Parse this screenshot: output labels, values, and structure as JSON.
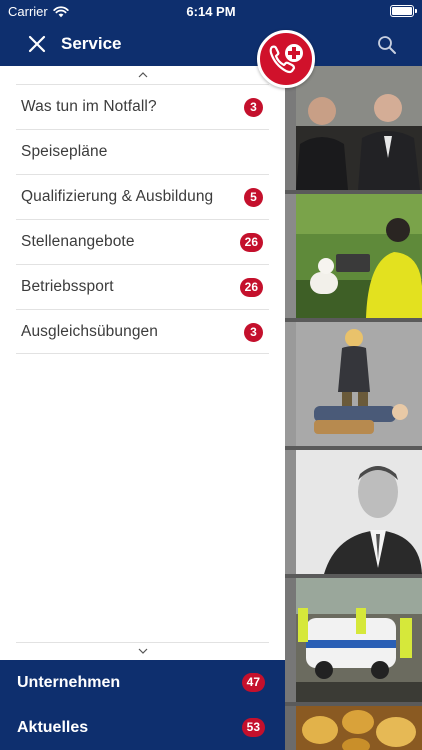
{
  "status_bar": {
    "carrier": "Carrier",
    "time": "6:14 PM"
  },
  "header": {
    "title": "Service"
  },
  "menu": {
    "items": [
      {
        "label": "Was tun im Notfall?",
        "badge": "3"
      },
      {
        "label": "Speisepläne",
        "badge": ""
      },
      {
        "label": "Qualifizierung & Ausbildung",
        "badge": "5"
      },
      {
        "label": "Stellenangebote",
        "badge": "26"
      },
      {
        "label": "Betriebssport",
        "badge": "26"
      },
      {
        "label": "Ausgleichsübungen",
        "badge": "3"
      }
    ]
  },
  "sections": [
    {
      "label": "Unternehmen",
      "badge": "47"
    },
    {
      "label": "Aktuelles",
      "badge": "53"
    }
  ],
  "colors": {
    "primary_navy": "#0e2f6e",
    "badge_red": "#c4102c",
    "emergency_red": "#d0112b"
  },
  "icons": {
    "close": "close-icon",
    "search": "search-icon",
    "emergency": "emergency-phone-icon",
    "scroll_up": "chevron-up-icon",
    "scroll_down": "chevron-down-icon"
  }
}
